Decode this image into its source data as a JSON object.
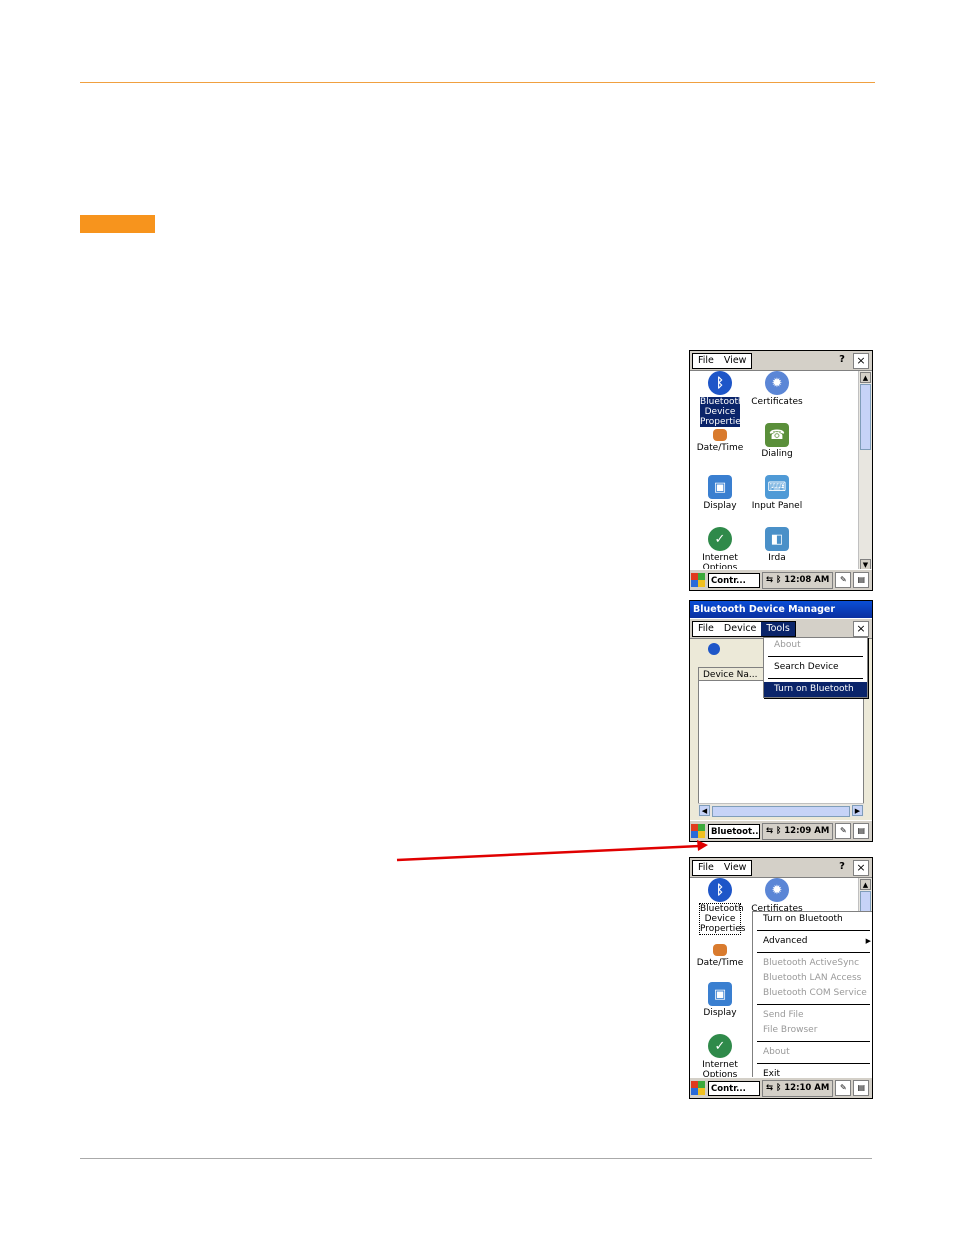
{
  "screen1": {
    "menu": [
      "File",
      "View"
    ],
    "help": "?",
    "close": "×",
    "icons": [
      {
        "label": "Bluetooth Device Properties",
        "icon": "bluetooth-icon",
        "color": "#1e56c8"
      },
      {
        "label": "Certificates",
        "icon": "gear-icon",
        "color": "#5b86d6"
      },
      {
        "label": "Date/Time",
        "icon": "calendar-icon",
        "color": "#d97b2e"
      },
      {
        "label": "Dialing",
        "icon": "phone-icon",
        "color": "#5a8f3a"
      },
      {
        "label": "Display",
        "icon": "monitor-icon",
        "color": "#3a7fd0"
      },
      {
        "label": "Input Panel",
        "icon": "keyboard-icon",
        "color": "#4f9ad6"
      },
      {
        "label": "Internet Options",
        "icon": "globe-icon",
        "color": "#2f8a4a"
      },
      {
        "label": "Irda",
        "icon": "irda-icon",
        "color": "#4a90c8"
      }
    ],
    "taskbar": {
      "task": "Contr...",
      "time": "12:08 AM"
    }
  },
  "screen2": {
    "title": "Bluetooth Device Manager",
    "menu": [
      "File",
      "Device",
      "Tools"
    ],
    "close": "×",
    "list_header": "Device Na...",
    "dropdown": [
      "About",
      "Search Device",
      "Turn on Bluetooth"
    ],
    "taskbar": {
      "task": "Bluetoot...",
      "time": "12:09 AM"
    }
  },
  "screen3": {
    "menu": [
      "File",
      "View"
    ],
    "help": "?",
    "close": "×",
    "icons": [
      {
        "label": "Bluetooth Device Properties",
        "icon": "bluetooth-icon"
      },
      {
        "label": "Certificates",
        "icon": "gear-icon"
      },
      {
        "label": "Date/Time",
        "icon": "calendar-icon"
      },
      {
        "label": "Display",
        "icon": "monitor-icon"
      },
      {
        "label": "Internet Options",
        "icon": "globe-icon"
      }
    ],
    "context_menu": {
      "turn_on": "Turn on Bluetooth",
      "advanced": "Advanced",
      "activesync": "Bluetooth ActiveSync",
      "lan": "Bluetooth LAN Access",
      "com": "Bluetooth COM Service",
      "send_file": "Send File",
      "file_browser": "File Browser",
      "about": "About",
      "exit": "Exit"
    },
    "taskbar": {
      "task": "Contr...",
      "time": "12:10 AM"
    }
  },
  "colors": {
    "accent_orange": "#f7941d",
    "arrow_red": "#e00000",
    "selection_blue": "#0a246a"
  }
}
